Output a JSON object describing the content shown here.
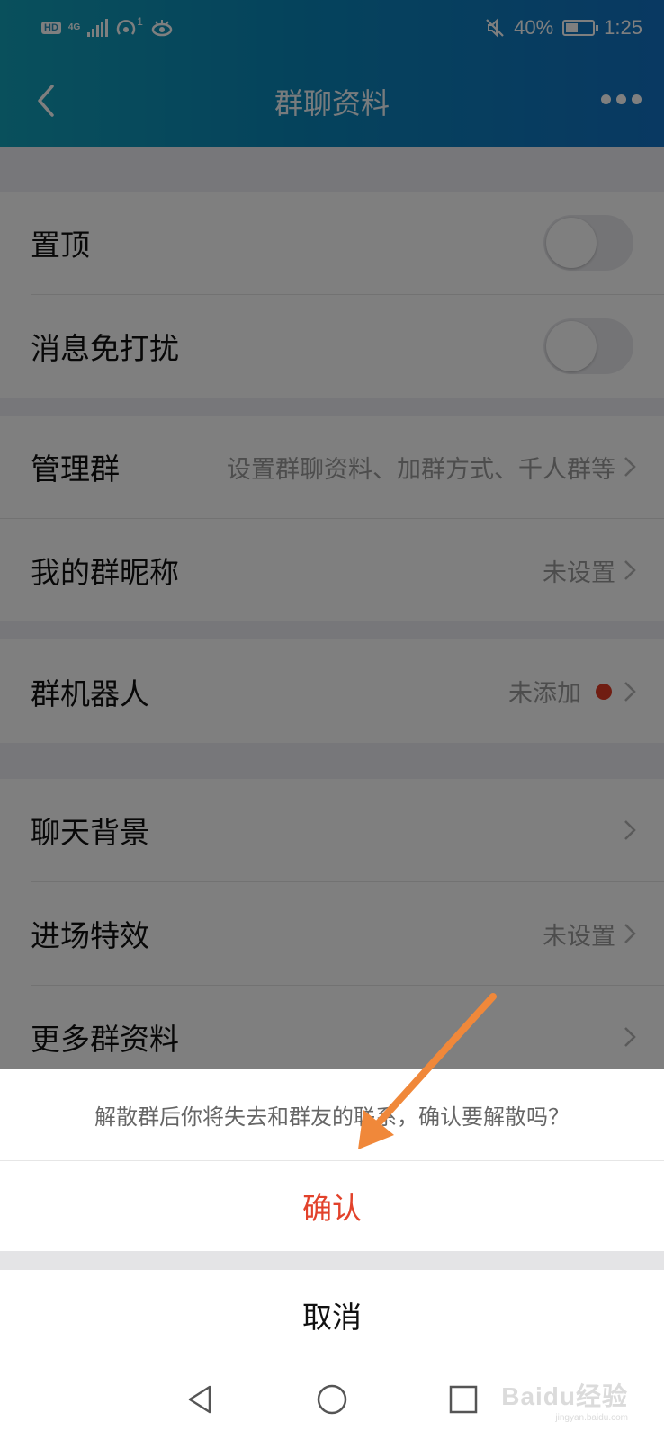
{
  "status_bar": {
    "hd": "HD",
    "network": "4G",
    "hotspot_count": "1",
    "battery": "40%",
    "time": "1:25"
  },
  "nav": {
    "title": "群聊资料",
    "back_icon": "chevron-left-icon",
    "more_icon": "more-dots-icon"
  },
  "settings": {
    "pin": {
      "label": "置顶",
      "on": false
    },
    "mute": {
      "label": "消息免打扰",
      "on": false
    },
    "manage": {
      "label": "管理群",
      "value": "设置群聊资料、加群方式、千人群等"
    },
    "nickname": {
      "label": "我的群昵称",
      "value": "未设置"
    },
    "robot": {
      "label": "群机器人",
      "value": "未添加"
    },
    "background": {
      "label": "聊天背景"
    },
    "entrance": {
      "label": "进场特效",
      "value": "未设置"
    },
    "more_info": {
      "label": "更多群资料"
    }
  },
  "dialog": {
    "message": "解散群后你将失去和群友的联系，确认要解散吗？",
    "confirm": "确认",
    "cancel": "取消"
  },
  "colors": {
    "header_start": "#12a0b8",
    "header_end": "#1272c4",
    "confirm": "#e2422b",
    "annotation_arrow": "#f0883a",
    "red_dot": "#e03a25"
  },
  "watermark": {
    "logo": "Baidu经验",
    "url": "jingyan.baidu.com"
  }
}
